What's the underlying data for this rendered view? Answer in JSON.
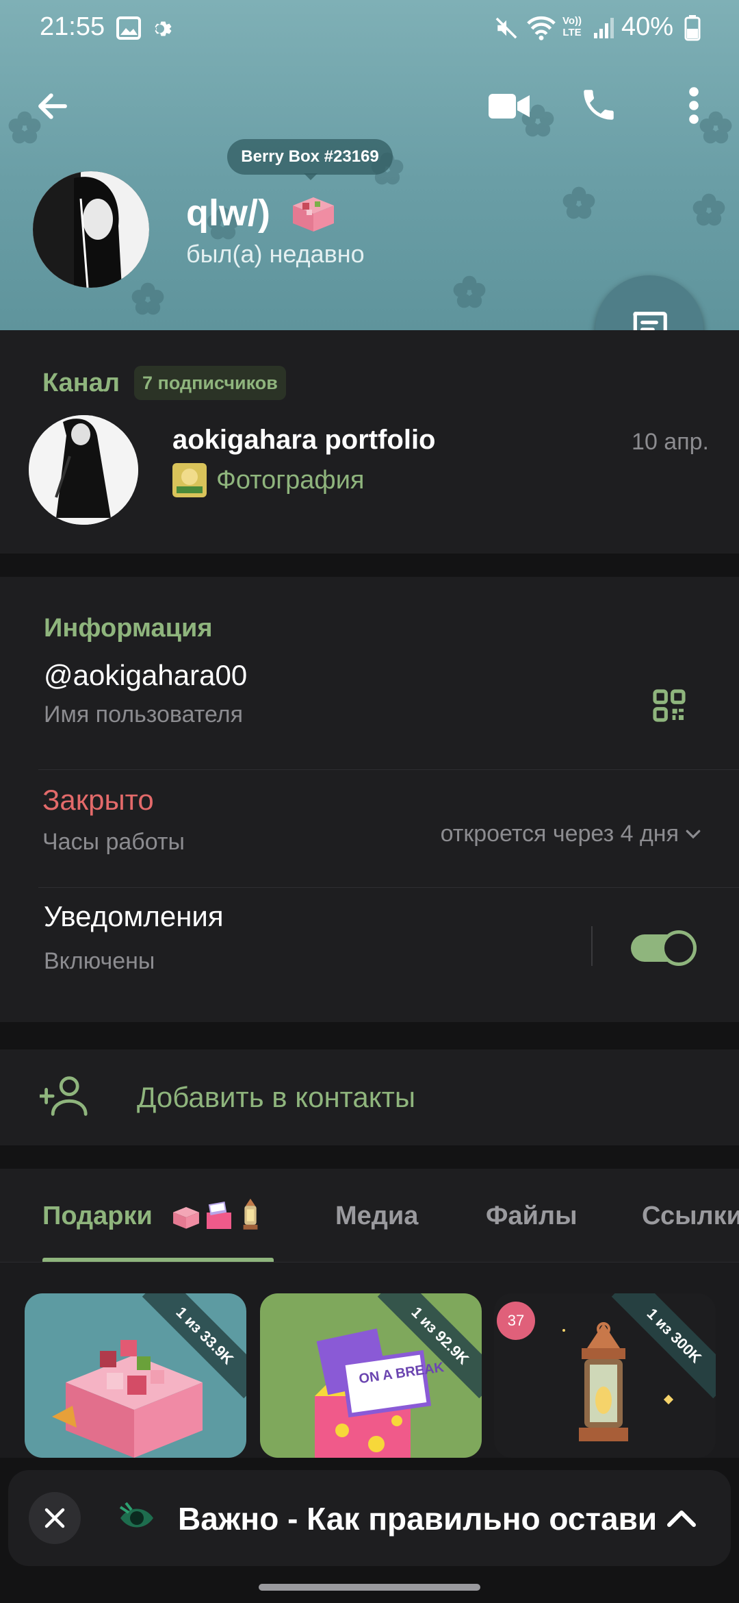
{
  "status_bar": {
    "time": "21:55",
    "battery": "40%",
    "icons": [
      "image-icon",
      "gear-icon",
      "mute-icon",
      "wifi-icon",
      "volte-icon",
      "signal-icon",
      "battery-icon"
    ]
  },
  "header": {
    "gift_badge": "Berry Box #23169",
    "name": "qlw/)",
    "status": "был(а) недавно",
    "icons": [
      "back-arrow-icon",
      "video-call-icon",
      "phone-icon",
      "more-vert-icon",
      "message-icon"
    ]
  },
  "channel": {
    "section_label": "Канал",
    "subscribers": "7 подписчиков",
    "name": "aokigahara portfolio",
    "date": "10 апр.",
    "subtitle": "Фотография"
  },
  "info": {
    "title": "Информация",
    "username": "@aokigahara00",
    "username_label": "Имя пользователя",
    "hours_status": "Закрыто",
    "hours_label": "Часы работы",
    "opens": "откроется через 4 дня",
    "notifications": "Уведомления",
    "notifications_state": "Включены",
    "notifications_on": true
  },
  "add_contact": {
    "label": "Добавить в контакты"
  },
  "tabs": [
    {
      "label": "Подарки"
    },
    {
      "label": "Медиа"
    },
    {
      "label": "Файлы"
    },
    {
      "label": "Ссылки"
    }
  ],
  "gifts": [
    {
      "ribbon": "1 из 33.9K"
    },
    {
      "ribbon": "1 из 92.9K",
      "sign": "ON A BREAK"
    },
    {
      "ribbon": "1 из 300K",
      "badge": "37"
    }
  ],
  "pinned": {
    "text": "Важно - Как правильно остави"
  },
  "colors": {
    "accent_green": "#8fb57d",
    "danger_red": "#e36a6a",
    "header_teal": "#6a9ea6",
    "fab": "#4f7e88"
  }
}
